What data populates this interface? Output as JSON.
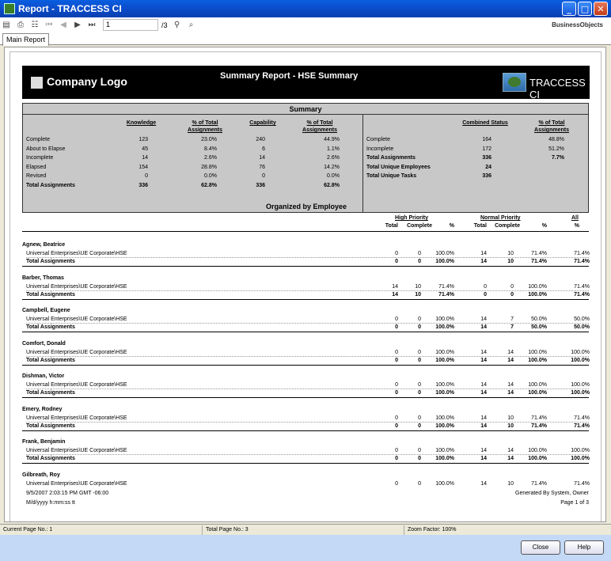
{
  "window": {
    "title": "Report - TRACCESS CI"
  },
  "toolbar": {
    "page_input": "1",
    "page_total": "/3",
    "brand": "BusinessObjects"
  },
  "tabs": [
    "Main Report"
  ],
  "banner": {
    "logo": "Company Logo",
    "title": "Summary Report - HSE Summary",
    "brand": "TRACCESS CI"
  },
  "summary": {
    "title": "Summary",
    "left_headers": [
      "Knowledge",
      "% of Total Assignments",
      "Capability",
      "% of Total Assignments"
    ],
    "left_rows": [
      {
        "label": "Complete",
        "v": [
          "123",
          "23.0%",
          "240",
          "44.9%"
        ],
        "bold": false
      },
      {
        "label": "About to Elapse",
        "v": [
          "45",
          "8.4%",
          "6",
          "1.1%"
        ],
        "bold": false
      },
      {
        "label": "Incomplete",
        "v": [
          "14",
          "2.6%",
          "14",
          "2.6%"
        ],
        "bold": false
      },
      {
        "label": "Elapsed",
        "v": [
          "154",
          "28.8%",
          "76",
          "14.2%"
        ],
        "bold": false
      },
      {
        "label": "Revised",
        "v": [
          "0",
          "0.0%",
          "0",
          "0.0%"
        ],
        "bold": false
      },
      {
        "label": "Total Assignments",
        "v": [
          "336",
          "62.8%",
          "336",
          "62.8%"
        ],
        "bold": true
      }
    ],
    "right_headers": [
      "Combined Status",
      "% of Total Assignments"
    ],
    "right_rows": [
      {
        "label": "Complete",
        "v": [
          "164",
          "48.8%"
        ],
        "bold": false
      },
      {
        "label": "Incomplete",
        "v": [
          "172",
          "51.2%"
        ],
        "bold": false
      },
      {
        "label": "Total Assignments",
        "v": [
          "336",
          "7.7%"
        ],
        "bold": true
      },
      {
        "label": "Total Unique Employees",
        "v": [
          "24",
          ""
        ],
        "bold": true
      },
      {
        "label": "Total Unique Tasks",
        "v": [
          "336",
          ""
        ],
        "bold": true
      }
    ]
  },
  "employees_section": {
    "title": "Organized by Employee",
    "groups": [
      "High Priority",
      "Normal Priority",
      "All"
    ],
    "col_headers": [
      "Total",
      "Complete",
      "%",
      "Total",
      "Complete",
      "%",
      "%"
    ],
    "org_label": "Universal Enterprises\\UE Corporate\\HSE",
    "total_label": "Total Assignments",
    "employees": [
      {
        "name": "Agnew, Beatrice",
        "row": [
          "0",
          "0",
          "100.0%",
          "14",
          "10",
          "71.4%",
          "71.4%"
        ],
        "total": [
          "0",
          "0",
          "100.0%",
          "14",
          "10",
          "71.4%",
          "71.4%"
        ]
      },
      {
        "name": "Barber, Thomas",
        "row": [
          "14",
          "10",
          "71.4%",
          "0",
          "0",
          "100.0%",
          "71.4%"
        ],
        "total": [
          "14",
          "10",
          "71.4%",
          "0",
          "0",
          "100.0%",
          "71.4%"
        ]
      },
      {
        "name": "Campbell, Eugene",
        "row": [
          "0",
          "0",
          "100.0%",
          "14",
          "7",
          "50.0%",
          "50.0%"
        ],
        "total": [
          "0",
          "0",
          "100.0%",
          "14",
          "7",
          "50.0%",
          "50.0%"
        ]
      },
      {
        "name": "Comfort, Donald",
        "row": [
          "0",
          "0",
          "100.0%",
          "14",
          "14",
          "100.0%",
          "100.0%"
        ],
        "total": [
          "0",
          "0",
          "100.0%",
          "14",
          "14",
          "100.0%",
          "100.0%"
        ]
      },
      {
        "name": "Dishman, Victor",
        "row": [
          "0",
          "0",
          "100.0%",
          "14",
          "14",
          "100.0%",
          "100.0%"
        ],
        "total": [
          "0",
          "0",
          "100.0%",
          "14",
          "14",
          "100.0%",
          "100.0%"
        ]
      },
      {
        "name": "Emery, Rodney",
        "row": [
          "0",
          "0",
          "100.0%",
          "14",
          "10",
          "71.4%",
          "71.4%"
        ],
        "total": [
          "0",
          "0",
          "100.0%",
          "14",
          "10",
          "71.4%",
          "71.4%"
        ]
      },
      {
        "name": "Frank, Benjamin",
        "row": [
          "0",
          "0",
          "100.0%",
          "14",
          "14",
          "100.0%",
          "100.0%"
        ],
        "total": [
          "0",
          "0",
          "100.0%",
          "14",
          "14",
          "100.0%",
          "100.0%"
        ]
      },
      {
        "name": "Gilbreath, Roy",
        "row": [
          "0",
          "0",
          "100.0%",
          "14",
          "10",
          "71.4%",
          "71.4%"
        ],
        "total": null
      }
    ]
  },
  "footer": {
    "datetime": "9/5/2007  2:03:15 PM GMT -06:00",
    "format": "M/d/yyyy h:mm:ss tt",
    "generated": "Generated By System, Owner",
    "page": "Page 1 of 3"
  },
  "statusbar": {
    "current": "Current Page No.: 1",
    "total": "Total Page No.: 3",
    "zoom": "Zoom Factor: 100%"
  },
  "buttons": {
    "close": "Close",
    "help": "Help"
  }
}
